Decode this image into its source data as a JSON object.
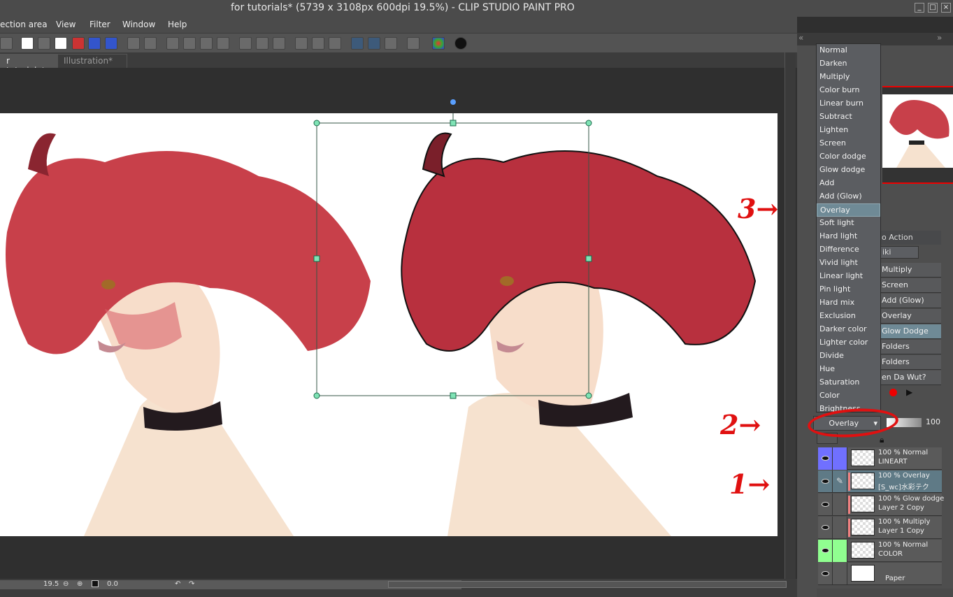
{
  "window": {
    "title": "for tutorials* (5739 x 3108px 600dpi 19.5%)  - CLIP STUDIO PAINT PRO"
  },
  "menu": [
    "ection area",
    "View",
    "Filter",
    "Window",
    "Help"
  ],
  "tabs": [
    {
      "label": "r tutorials*",
      "active": true
    },
    {
      "label": "Illustration*",
      "active": false
    }
  ],
  "blend_menu": {
    "items": [
      "Normal",
      "Darken",
      "Multiply",
      "Color burn",
      "Linear burn",
      "Subtract",
      "Lighten",
      "Screen",
      "Color dodge",
      "Glow dodge",
      "Add",
      "Add (Glow)",
      "Overlay",
      "Soft light",
      "Hard light",
      "Difference",
      "Vivid light",
      "Linear light",
      "Pin light",
      "Hard mix",
      "Exclusion",
      "Darker color",
      "Lighter color",
      "Divide",
      "Hue",
      "Saturation",
      "Color",
      "Brightness"
    ],
    "selected": "Overlay"
  },
  "auto_action": {
    "tab": "o Action",
    "set": "iki",
    "items": [
      "Multiply",
      "Screen",
      "Add (Glow)",
      "Overlay",
      "Glow Dodge",
      "Folders",
      "Folders",
      "en Da Wut?"
    ],
    "selected": "Glow Dodge"
  },
  "layer_panel": {
    "blend_mode": "Overlay",
    "opacity": "100",
    "layers": [
      {
        "line1": "100 % Normal",
        "line2": "LINEART",
        "color": "#7070ff"
      },
      {
        "line1": "100 % Overlay",
        "line2": "[S_wc]水彩テク",
        "selected": true
      },
      {
        "line1": "100 % Glow dodge",
        "line2": "Layer 2 Copy"
      },
      {
        "line1": "100 % Multiply",
        "line2": "Layer 1 Copy"
      },
      {
        "line1": "100 % Normal",
        "line2": "COLOR",
        "color": "#90ff90"
      },
      {
        "line1": "",
        "line2": "Paper"
      }
    ]
  },
  "status": {
    "zoom": "19.5",
    "rotation": "0.0"
  },
  "annotations": {
    "a1": "1→",
    "a2": "2→",
    "a3": "3→"
  },
  "colors": {
    "annotation": "#e01010",
    "selection": "#6f8a96"
  }
}
